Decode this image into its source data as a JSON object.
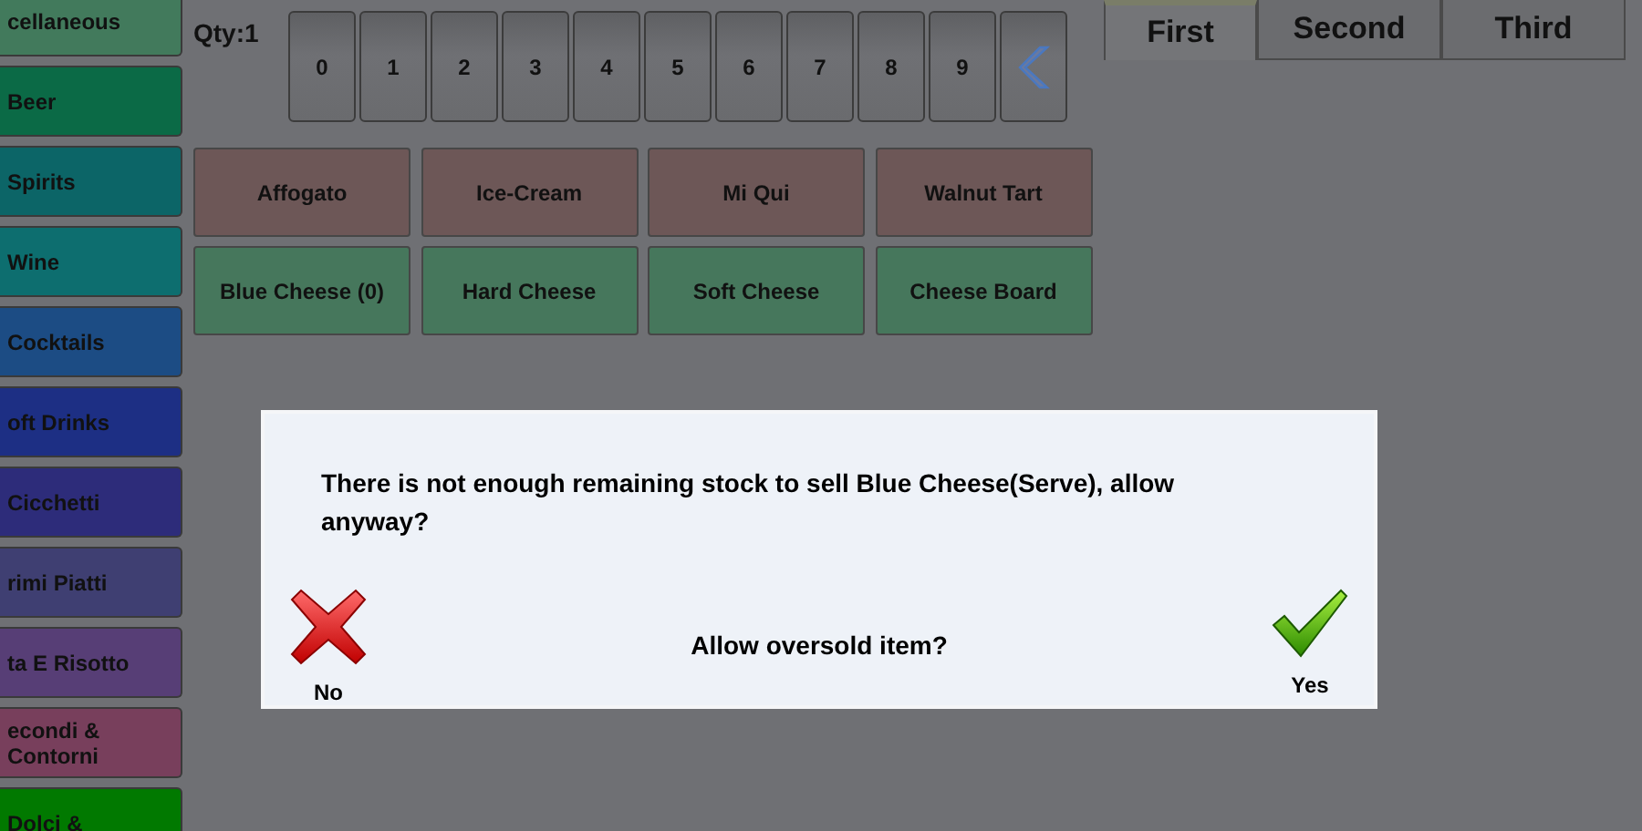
{
  "categories": [
    {
      "label": "cellaneous",
      "color": "#427a5c"
    },
    {
      "label": "Beer",
      "color": "#0b6a46"
    },
    {
      "label": "Spirits",
      "color": "#0c6567"
    },
    {
      "label": "Wine",
      "color": "#0d6e6f"
    },
    {
      "label": "Cocktails",
      "color": "#1c4c84"
    },
    {
      "label": "oft Drinks",
      "color": "#1d2f84"
    },
    {
      "label": "Cicchetti",
      "color": "#2d2c7a"
    },
    {
      "label": "rimi Piatti",
      "color": "#3f3f72"
    },
    {
      "label": "ta E Risotto",
      "color": "#573e76"
    },
    {
      "label": "econdi & Contorni",
      "color": "#783f5c"
    },
    {
      "label": "Dolci &",
      "color": "#017900"
    }
  ],
  "quantity": "Qty:1",
  "keypad": [
    "0",
    "1",
    "2",
    "3",
    "4",
    "5",
    "6",
    "7",
    "8",
    "9"
  ],
  "tabs": [
    {
      "label": "First",
      "selected": true
    },
    {
      "label": "Second",
      "selected": false
    },
    {
      "label": "Third",
      "selected": false
    }
  ],
  "items": [
    {
      "label": "Affogato",
      "color": "#6d5757"
    },
    {
      "label": "Ice-Cream",
      "color": "#6d5757"
    },
    {
      "label": "Mi Qui",
      "color": "#6d5757"
    },
    {
      "label": "Walnut Tart",
      "color": "#6d5757"
    },
    {
      "label": "Blue Cheese (0)",
      "color": "#46775c"
    },
    {
      "label": "Hard Cheese",
      "color": "#46775c"
    },
    {
      "label": "Soft Cheese",
      "color": "#46775c"
    },
    {
      "label": "Cheese Board",
      "color": "#46775c"
    }
  ],
  "dialog": {
    "message": "There is not enough remaining stock to sell Blue Cheese(Serve), allow anyway?",
    "question": "Allow oversold item?",
    "no_label": "No",
    "yes_label": "Yes"
  }
}
